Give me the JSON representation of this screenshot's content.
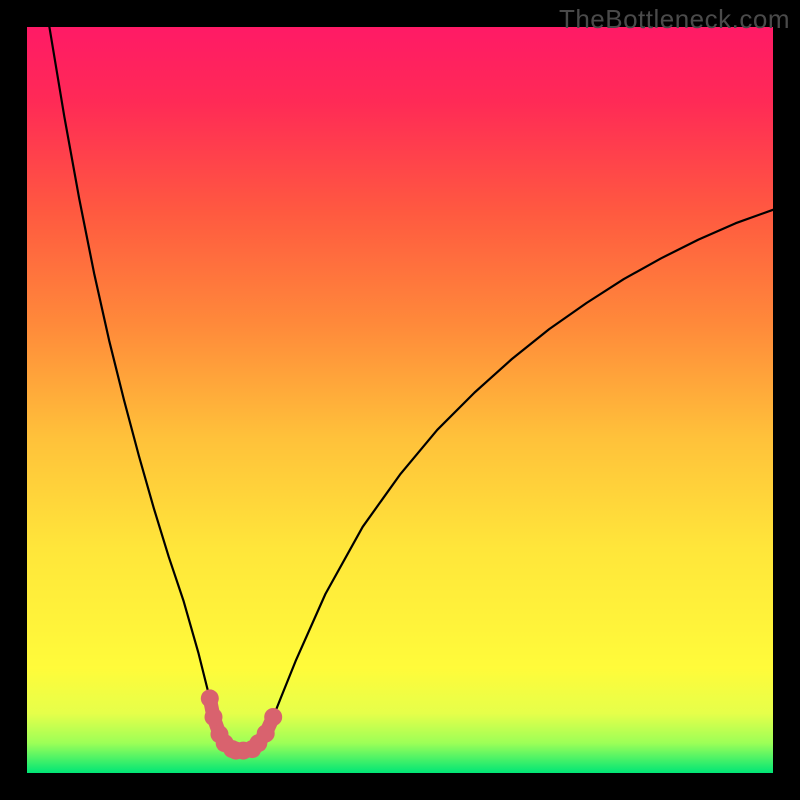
{
  "watermark": "TheBottleneck.com",
  "accent_marker_color": "#d9626e",
  "curve_color": "#000000",
  "chart_data": {
    "type": "line",
    "title": "",
    "xlabel": "",
    "ylabel": "",
    "xlim": [
      0,
      100
    ],
    "ylim": [
      0,
      100
    ],
    "series": [
      {
        "name": "bottleneck-curve",
        "x": [
          3,
          5,
          7,
          9,
          11,
          13,
          15,
          17,
          19,
          21,
          23,
          24.5,
          25,
          25.8,
          26.5,
          27.5,
          28,
          29,
          30.2,
          31,
          32,
          33,
          34,
          36,
          40,
          45,
          50,
          55,
          60,
          65,
          70,
          75,
          80,
          85,
          90,
          95,
          100
        ],
        "values": [
          100,
          88,
          77,
          67,
          58,
          50,
          42.5,
          35.5,
          29,
          23,
          16,
          10,
          7.5,
          5.2,
          4,
          3.2,
          3,
          3,
          3.2,
          4,
          5.3,
          7.5,
          10,
          15,
          24,
          33,
          40,
          46,
          51,
          55.5,
          59.5,
          63,
          66.2,
          69,
          71.5,
          73.7,
          75.5
        ]
      }
    ],
    "markers": {
      "name": "bottom-highlight",
      "x": [
        24.5,
        25,
        25.8,
        26.5,
        27.5,
        28,
        29,
        30.2,
        31,
        32,
        33
      ],
      "values": [
        10,
        7.5,
        5.2,
        4,
        3.2,
        3,
        3,
        3.2,
        4,
        5.3,
        7.5
      ]
    }
  }
}
